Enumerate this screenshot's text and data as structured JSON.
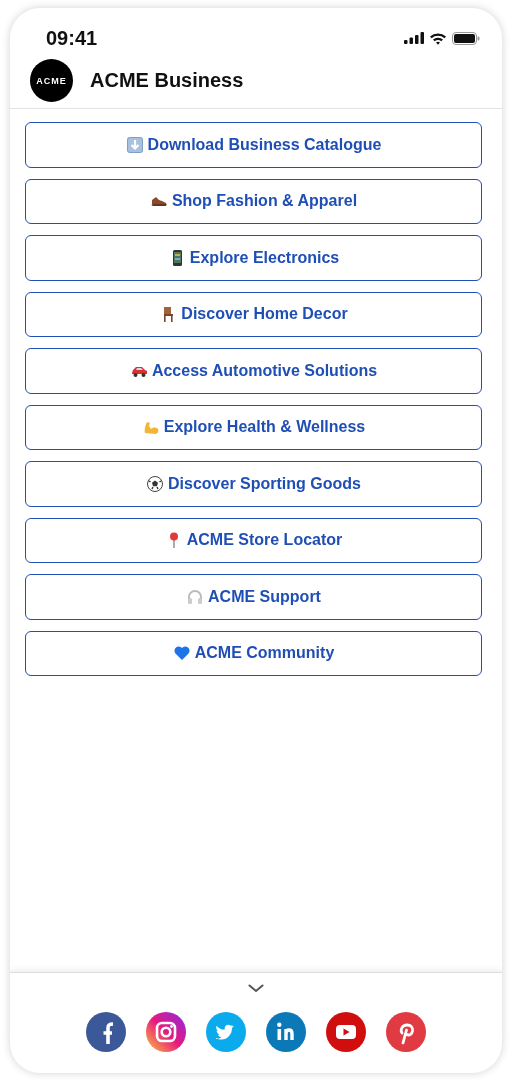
{
  "status_bar": {
    "time": "09:41"
  },
  "header": {
    "logo": "ACME",
    "title": "ACME Business"
  },
  "links": [
    {
      "kind": "download",
      "label": "Download Business Catalogue"
    },
    {
      "kind": "shoe",
      "label": "Shop Fashion & Apparel"
    },
    {
      "kind": "phone",
      "label": "Explore Electronics"
    },
    {
      "kind": "chair",
      "label": "Discover Home Decor"
    },
    {
      "kind": "car",
      "label": "Access Automotive Solutions"
    },
    {
      "kind": "muscle",
      "label": "Explore Health & Wellness"
    },
    {
      "kind": "ball",
      "label": "Discover Sporting Goods"
    },
    {
      "kind": "pin",
      "label": "ACME Store Locator"
    },
    {
      "kind": "headphones",
      "label": "ACME Support"
    },
    {
      "kind": "heart",
      "label": "ACME Community"
    }
  ],
  "social": [
    {
      "kind": "facebook"
    },
    {
      "kind": "instagram"
    },
    {
      "kind": "twitter"
    },
    {
      "kind": "linkedin"
    },
    {
      "kind": "youtube"
    },
    {
      "kind": "pinterest"
    }
  ]
}
